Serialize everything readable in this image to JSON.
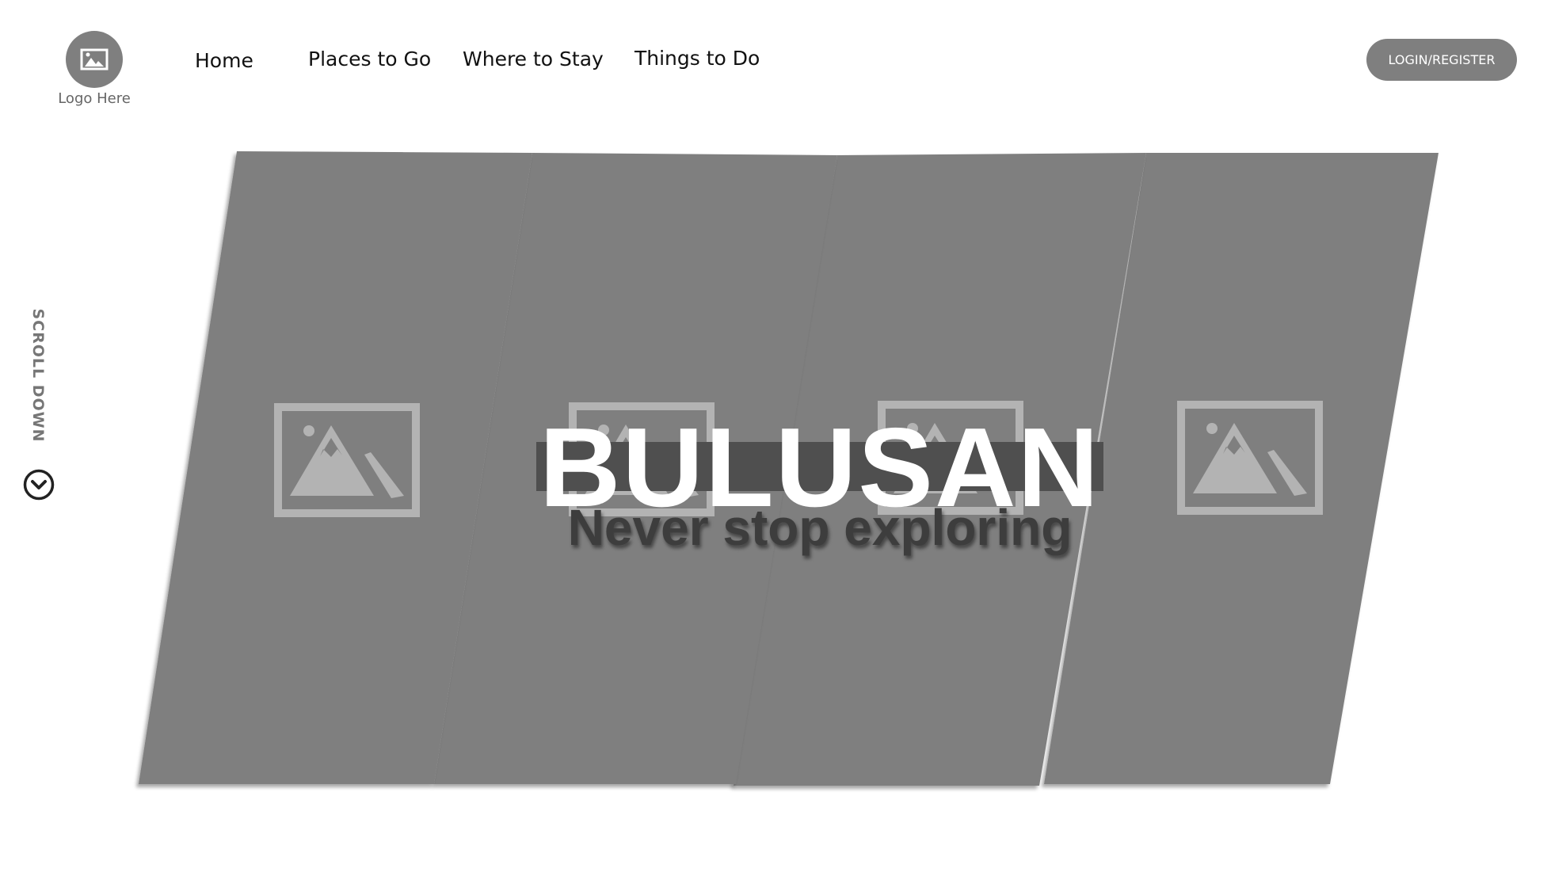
{
  "logo": {
    "text": "Logo Here",
    "icon": "image-placeholder-icon"
  },
  "nav": {
    "items": [
      {
        "label": "Home"
      },
      {
        "label": "Places to Go"
      },
      {
        "label": "Where to Stay"
      },
      {
        "label": "Things to Do"
      }
    ]
  },
  "auth": {
    "login_label": "LOGIN/REGISTER"
  },
  "scroll": {
    "label": "SCROLL DOWN",
    "icon": "chevron-down-circle-icon"
  },
  "hero": {
    "title": "BULUSAN",
    "subtitle": "Never stop exploring",
    "panel_icon": "image-placeholder-icon"
  },
  "colors": {
    "panel": "#7f7f7f",
    "placeholder": "#b3b3b3",
    "title_bar": "#4f4f4f",
    "title": "#ffffff",
    "subtitle": "#3d3d3d"
  }
}
